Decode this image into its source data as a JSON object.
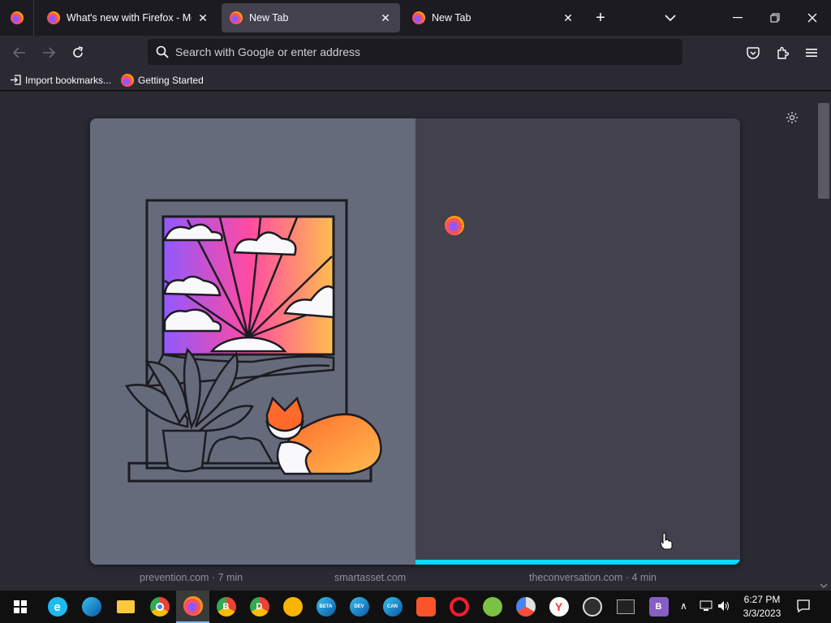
{
  "tabs": [
    {
      "label": "What's new with Firefox - More",
      "selected": false
    },
    {
      "label": "New Tab",
      "selected": true
    },
    {
      "label": "New Tab",
      "selected": false
    }
  ],
  "window": {
    "new_tab_symbol": "+",
    "list_all_tabs_icon": "chevron-down-icon"
  },
  "nav": {
    "search_placeholder": "Search with Google or enter address"
  },
  "bookmarks": [
    {
      "label": "Import bookmarks...",
      "icon": "import-icon"
    },
    {
      "label": "Getting Started",
      "icon": "firefox-icon"
    }
  ],
  "cards": [
    {
      "label": "prevention.com · 7 min"
    },
    {
      "label": "smartasset.com"
    },
    {
      "label": "theconversation.com · 4 min"
    }
  ],
  "colors": {
    "accent": "#00ddff",
    "illustration_bg": "#656b7b",
    "panel_bg": "#42414d"
  },
  "taskbar": {
    "apps": [
      "Internet Explorer",
      "Edge",
      "File Explorer",
      "Chrome",
      "Firefox",
      "Edge Beta B",
      "Edge Dev D",
      "Chrome Canary",
      "Edge Beta",
      "Edge Dev",
      "Edge Canary",
      "Brave",
      "Opera",
      "Opera GX",
      "Chromium",
      "Yandex",
      "OBS",
      "Terminal",
      "Visual Studio"
    ],
    "time": "6:27 PM",
    "date": "3/3/2023"
  }
}
